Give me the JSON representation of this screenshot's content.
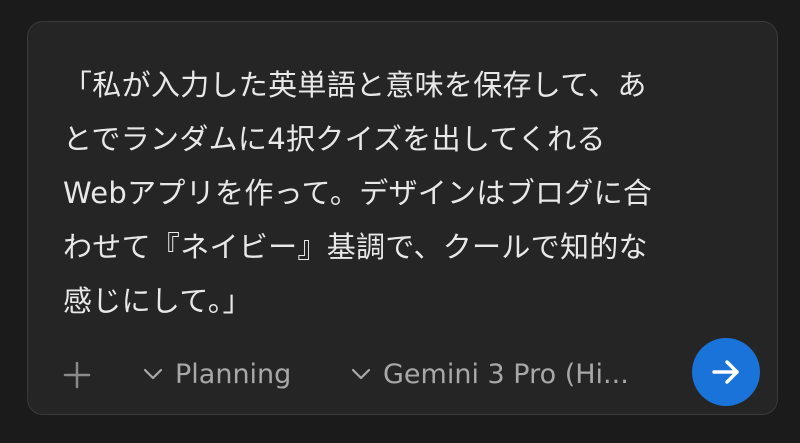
{
  "prompt": {
    "lines": [
      "「私が入力した英単語と意味を保存して、あ",
      "とでランダムに4択クイズを出してくれる",
      "Webアプリを作って。デザインはブログに合",
      "わせて『ネイビー』基調で、クールで知的な",
      "感じにして。」"
    ]
  },
  "toolbar": {
    "mode_label": "Planning",
    "model_label": "Gemini 3 Pro (Hi..."
  },
  "icons": {
    "add": "plus-icon",
    "mode_chevron": "chevron-down-icon",
    "model_chevron": "chevron-down-icon",
    "send": "arrow-right-icon"
  },
  "colors": {
    "send_button": "#1a73d8",
    "background": "#1b1b1b",
    "panel": "#252525"
  }
}
